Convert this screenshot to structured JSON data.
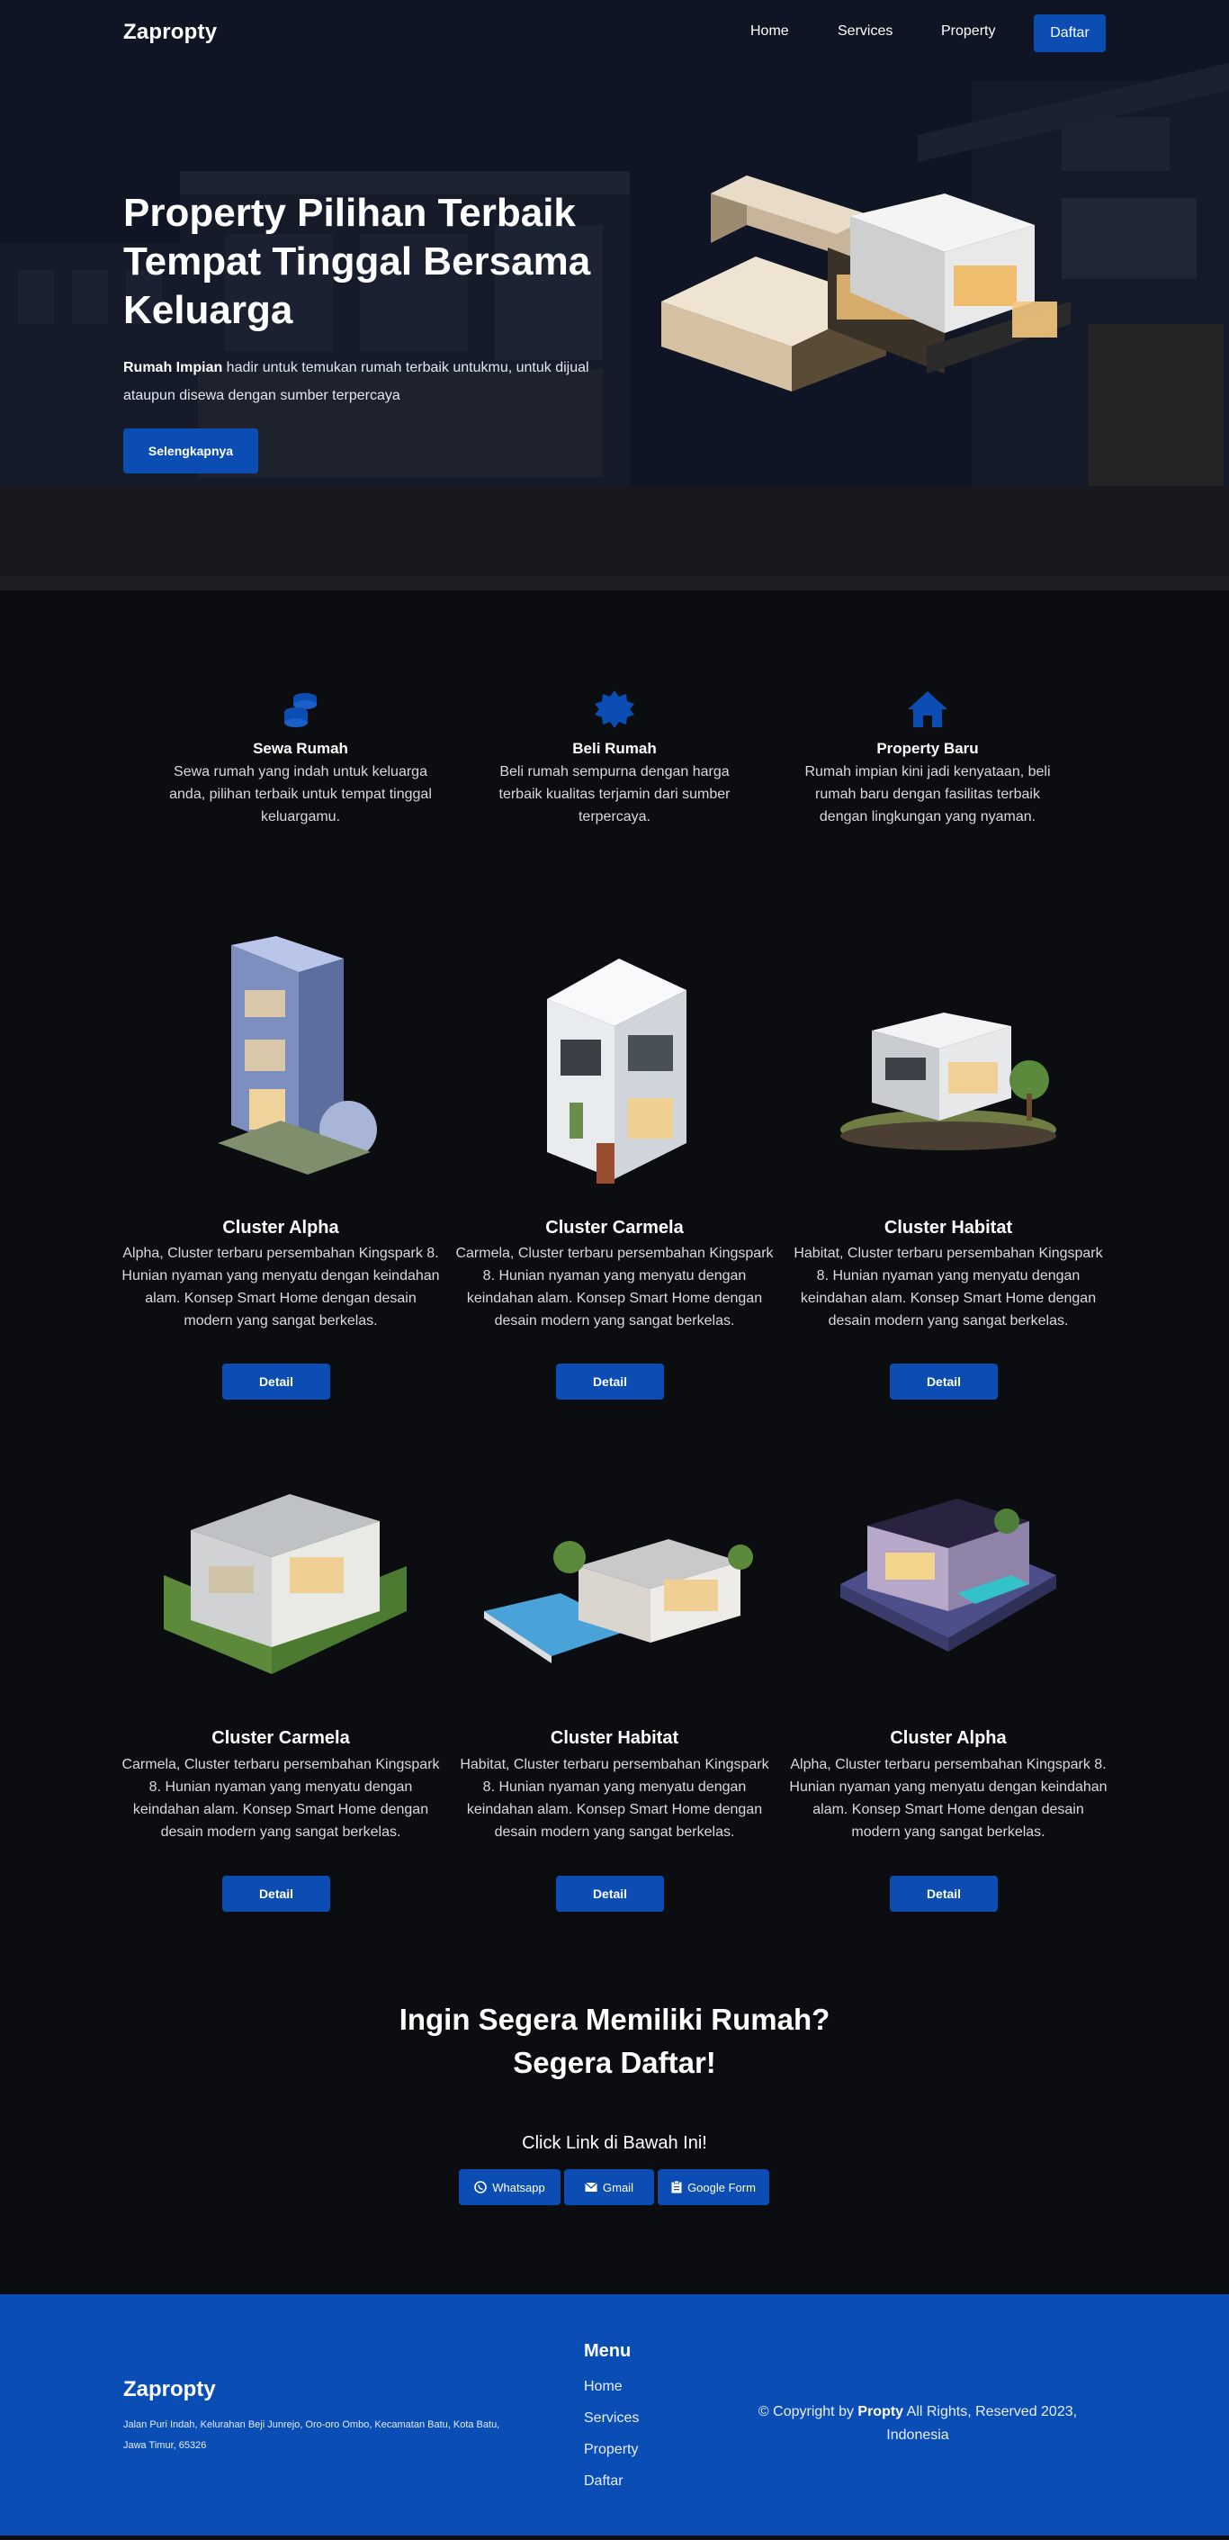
{
  "nav": {
    "brand": "Zapropty",
    "links": [
      "Home",
      "Services",
      "Property"
    ],
    "cta": "Daftar"
  },
  "hero": {
    "title": "Property Pilihan Terbaik Tempat Tinggal Bersama Keluarga",
    "desc_bold": "Rumah Impian",
    "desc_rest": " hadir untuk temukan rumah terbaik untukmu, untuk dijual ataupun disewa dengan sumber terpercaya",
    "button": "Selengkapnya"
  },
  "features": [
    {
      "icon": "coins-icon",
      "title": "Sewa Rumah",
      "desc": "Sewa rumah yang indah untuk keluarga anda, pilihan terbaik untuk tempat tinggal keluargamu."
    },
    {
      "icon": "badge-icon",
      "title": "Beli Rumah",
      "desc": "Beli rumah sempurna dengan harga terbaik kualitas terjamin dari sumber terpercaya."
    },
    {
      "icon": "home-icon",
      "title": "Property Baru",
      "desc": "Rumah impian kini jadi kenyataan, beli rumah baru dengan fasilitas terbaik dengan lingkungan yang nyaman."
    }
  ],
  "properties": [
    {
      "title": "Cluster Alpha",
      "desc": "Alpha, Cluster terbaru persembahan Kingspark 8. Hunian nyaman yang menyatu dengan keindahan alam. Konsep Smart Home dengan desain modern yang sangat berkelas.",
      "button": "Detail"
    },
    {
      "title": "Cluster Carmela",
      "desc": "Carmela, Cluster terbaru persembahan Kingspark 8. Hunian nyaman yang menyatu dengan keindahan alam. Konsep Smart Home dengan desain modern yang sangat berkelas.",
      "button": "Detail"
    },
    {
      "title": "Cluster Habitat",
      "desc": "Habitat, Cluster terbaru persembahan Kingspark 8. Hunian nyaman yang menyatu dengan keindahan alam. Konsep Smart Home dengan desain modern yang sangat berkelas.",
      "button": "Detail"
    },
    {
      "title": "Cluster Carmela",
      "desc": "Carmela, Cluster terbaru persembahan Kingspark 8. Hunian nyaman yang menyatu dengan keindahan alam. Konsep Smart Home dengan desain modern yang sangat berkelas.",
      "button": "Detail"
    },
    {
      "title": "Cluster Habitat",
      "desc": "Habitat, Cluster terbaru persembahan Kingspark 8. Hunian nyaman yang menyatu dengan keindahan alam. Konsep Smart Home dengan desain modern yang sangat berkelas.",
      "button": "Detail"
    },
    {
      "title": "Cluster Alpha",
      "desc": "Alpha, Cluster terbaru persembahan Kingspark 8. Hunian nyaman yang menyatu dengan keindahan alam. Konsep Smart Home dengan desain modern yang sangat berkelas.",
      "button": "Detail"
    }
  ],
  "cta": {
    "title_line1": "Ingin Segera Memiliki Rumah?",
    "title_line2": "Segera Daftar!",
    "subtitle": "Click Link di Bawah Ini!",
    "buttons": [
      {
        "icon": "whatsapp-icon",
        "label": "Whatsapp"
      },
      {
        "icon": "mail-icon",
        "label": "Gmail"
      },
      {
        "icon": "form-icon",
        "label": "Google Form"
      }
    ]
  },
  "footer": {
    "brand": "Zapropty",
    "address": "Jalan Puri Indah, Kelurahan Beji Junrejo, Oro-oro Ombo, Kecamatan Batu, Kota Batu, Jawa Timur, 65326",
    "menu_title": "Menu",
    "menu": [
      "Home",
      "Services",
      "Property",
      "Daftar"
    ],
    "copy_pre": "© Copyright by ",
    "copy_brand": "Propty",
    "copy_post": " All Rights, Reserved 2023, Indonesia"
  },
  "colors": {
    "accent": "#0b4db3",
    "background": "#0b0d10",
    "footer": "#0a4db5"
  }
}
